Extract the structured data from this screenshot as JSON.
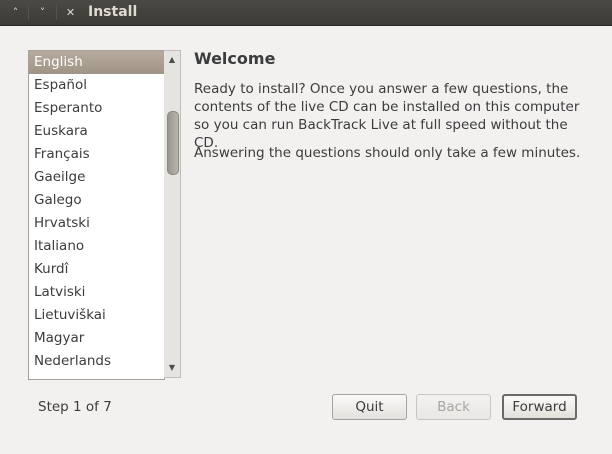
{
  "window": {
    "title": "Install",
    "min_glyph": "˄",
    "max_glyph": "˅",
    "close_glyph": "✕"
  },
  "languages": {
    "selected_index": 0,
    "items": [
      "English",
      "Español",
      "Esperanto",
      "Euskara",
      "Français",
      "Gaeilge",
      "Galego",
      "Hrvatski",
      "Italiano",
      "Kurdî",
      "Latviski",
      "Lietuviškai",
      "Magyar",
      "Nederlands"
    ]
  },
  "welcome": {
    "heading": "Welcome",
    "paragraph1": "Ready to install?  Once you answer a few questions, the contents of the live CD can be installed on this computer so you can run BackTrack Live at full speed without the CD.",
    "paragraph2": "Answering the questions should only take a few minutes."
  },
  "footer": {
    "step": "Step 1 of 7",
    "quit_label": "Quit",
    "back_label": "Back",
    "forward_label": "Forward"
  }
}
